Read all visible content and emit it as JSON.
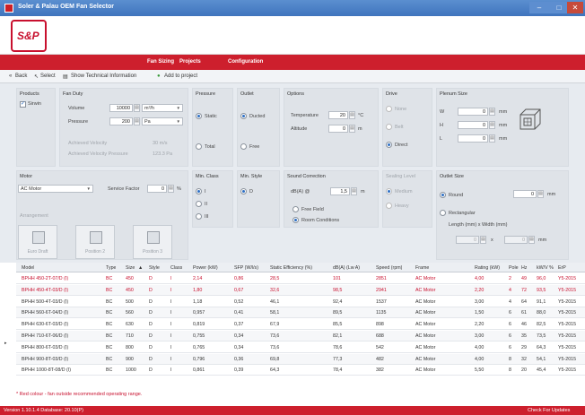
{
  "window": {
    "title": "Soler & Palau OEM Fan Selector",
    "min": "–",
    "max": "□",
    "close": "✕"
  },
  "logo": {
    "text": "S&P"
  },
  "nav": [
    "Fan Sizing",
    "Projects",
    "Configuration"
  ],
  "toolbar": {
    "back": "Back",
    "select": "Select",
    "show_tech": "Show Technical Information",
    "add_project": "Add to project"
  },
  "products": {
    "title": "Products",
    "item": "Sirwin"
  },
  "fan_duty": {
    "title": "Fan Duty",
    "volume_label": "Volume",
    "volume_value": "10000",
    "volume_unit": "m³/h",
    "pressure_label": "Pressure",
    "pressure_value": "200",
    "pressure_unit": "Pa",
    "inlet_velocity_label": "Achieved Velocity",
    "inlet_velocity_value": "30 m/s",
    "outlet_velocity_label": "Achieved Velocity Pressure",
    "outlet_velocity_value": "123.3 Pa"
  },
  "pressure": {
    "title": "Pressure",
    "static": "Static",
    "total": "Total"
  },
  "outlet": {
    "title": "Outlet",
    "ducted": "Ducted",
    "free": "Free"
  },
  "options": {
    "title": "Options",
    "temperature_label": "Temperature",
    "temperature_value": "20",
    "temperature_unit": "°C",
    "altitude_label": "Altitude",
    "altitude_value": "0",
    "altitude_unit": "m"
  },
  "drive": {
    "title": "Drive",
    "none": "None",
    "belt": "Belt",
    "direct": "Direct"
  },
  "plenum": {
    "title": "Plenum Size",
    "w_label": "W",
    "w_value": "0",
    "h_label": "H",
    "h_value": "0",
    "l_label": "L",
    "l_value": "0",
    "unit": "mm"
  },
  "motor": {
    "title": "Motor",
    "value": "AC Motor",
    "service_factor_label": "Service Factor",
    "service_factor_value": "0",
    "service_factor_unit": "%"
  },
  "arrangement": {
    "title": "Arrangement",
    "b1": "Euro Draft",
    "b2": "Position 2",
    "b3": "Position 3"
  },
  "min_class": {
    "title": "Min. Class",
    "i": "I",
    "ii": "II",
    "iii": "III"
  },
  "min_style": {
    "title": "Min. Style",
    "d": "D"
  },
  "sound": {
    "title": "Sound Correction",
    "db_label": "dB(A) @",
    "db_value": "1,5",
    "db_unit": "m",
    "free_field": "Free Field",
    "room": "Room Conditions"
  },
  "sealing": {
    "title": "Sealing Level",
    "medium": "Medium",
    "heavy": "Heavy"
  },
  "outlet_size": {
    "title": "Outlet Size",
    "round": "Round",
    "round_value": "0",
    "unit": "mm",
    "rect": "Rectangular",
    "rect_label": "Length (mm) x Width (mm)",
    "len_value": "0",
    "x": "x",
    "wid_value": "0"
  },
  "table": {
    "headers": [
      "Model",
      "Type",
      "Size",
      "Style",
      "Class",
      "Power (kW)",
      "SFP (W/l/s)",
      "Static Efficiency (%)",
      "dB(A) (Lw A)",
      "Speed (rpm)",
      "Frame",
      "Rating (kW)",
      "Pole",
      "Hz",
      "kW/V %",
      "ErP"
    ],
    "sort_mark": "▲",
    "rows": [
      {
        "color": "red",
        "cells": [
          "BPHH 450-2T-07/D (I)",
          "BC",
          "450",
          "D",
          "I",
          "2,14",
          "0,86",
          "28,5",
          "101",
          "2851",
          "AC Motor",
          "4,00",
          "2",
          "49",
          "96,0",
          "Y5-2015"
        ]
      },
      {
        "color": "red",
        "cells": [
          "BPHH 450-4T-03/D (I)",
          "BC",
          "450",
          "D",
          "I",
          "1,80",
          "0,67",
          "32,6",
          "98,5",
          "2941",
          "AC Motor",
          "2,20",
          "4",
          "72",
          "93,5",
          "Y5-2015"
        ]
      },
      {
        "color": "blk",
        "cells": [
          "BPHH 500-4T-03/D (I)",
          "BC",
          "500",
          "D",
          "I",
          "1,18",
          "0,52",
          "46,1",
          "92,4",
          "1537",
          "AC Motor",
          "3,00",
          "4",
          "64",
          "91,1",
          "Y5-2015"
        ]
      },
      {
        "color": "blk",
        "cells": [
          "BPHH 560-6T-04/D (I)",
          "BC",
          "560",
          "D",
          "I",
          "0,957",
          "0,41",
          "58,1",
          "89,5",
          "1135",
          "AC Motor",
          "1,50",
          "6",
          "61",
          "88,0",
          "Y5-2015"
        ]
      },
      {
        "color": "blk",
        "cells": [
          "BPHH 630-6T-03/D (I)",
          "BC",
          "630",
          "D",
          "I",
          "0,819",
          "0,37",
          "67,9",
          "85,5",
          "898",
          "AC Motor",
          "2,20",
          "6",
          "46",
          "82,5",
          "Y5-2015"
        ]
      },
      {
        "color": "blk",
        "cells": [
          "BPHH 710-6T-06/D (I)",
          "BC",
          "710",
          "D",
          "I",
          "0,755",
          "0,34",
          "73,6",
          "82,1",
          "688",
          "AC Motor",
          "3,00",
          "6",
          "35",
          "73,5",
          "Y5-2015"
        ]
      },
      {
        "color": "blk",
        "cells": [
          "BPHH 800-6T-03/D (I)",
          "BC",
          "800",
          "D",
          "I",
          "0,765",
          "0,34",
          "73,6",
          "78,6",
          "542",
          "AC Motor",
          "4,00",
          "6",
          "29",
          "64,3",
          "Y5-2015"
        ]
      },
      {
        "color": "blk",
        "cells": [
          "BPHH 900-8T-03/D (I)",
          "BC",
          "900",
          "D",
          "I",
          "0,796",
          "0,36",
          "69,8",
          "77,3",
          "482",
          "AC Motor",
          "4,00",
          "8",
          "32",
          "54,1",
          "Y5-2015"
        ]
      },
      {
        "color": "blk",
        "cells": [
          "BPHH 1000-8T-08/D (I)",
          "BC",
          "1000",
          "D",
          "I",
          "0,861",
          "0,39",
          "64,3",
          "78,4",
          "382",
          "AC Motor",
          "5,50",
          "8",
          "20",
          "45,4",
          "Y5-2015"
        ]
      }
    ]
  },
  "note": "* Red colour - fan outside recommended operating range.",
  "status": {
    "version": "Version 1.10.1.4 Database: 20.10(P)",
    "updates": "Check For Updates"
  }
}
